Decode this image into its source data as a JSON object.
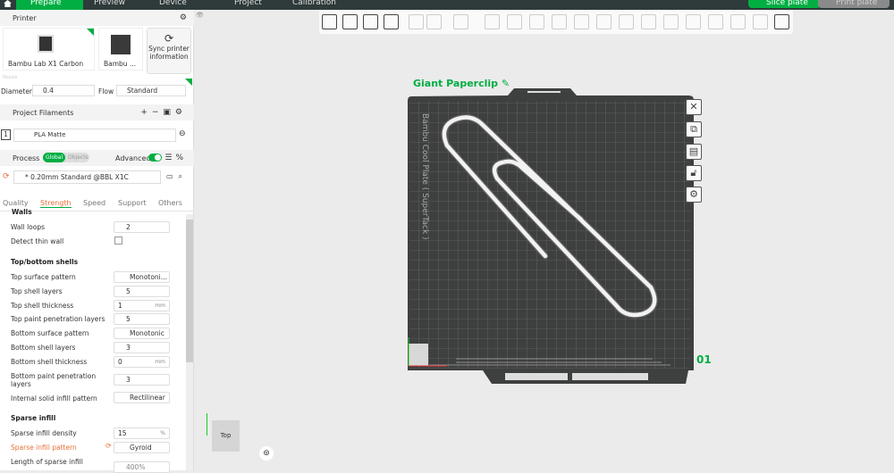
{
  "topbar": {
    "tabs": [
      "Prepare",
      "Preview",
      "Device",
      "Project",
      "Calibration"
    ],
    "slice_label": "Slice plate",
    "print_label": "Print plate"
  },
  "printer": {
    "title": "Printer",
    "name1": "Bambu Lab X1 Carbon",
    "name2": "Bambu ...",
    "sync_label": "Sync printer information",
    "nozzle_label": "Nozzle",
    "diameter_label": "Diameter",
    "diameter_value": "0.4",
    "flow_label": "Flow",
    "flow_value": "Standard"
  },
  "filaments": {
    "title": "Project Filaments",
    "items": [
      {
        "index": "1",
        "name": "PLA Matte"
      }
    ]
  },
  "process": {
    "title": "Process",
    "global_label": "Global",
    "objects_label": "Objects",
    "advanced_label": "Advanced",
    "advanced_on": true,
    "preset": "* 0.20mm Standard @BBL X1C",
    "tabs": [
      "Quality",
      "Strength",
      "Speed",
      "Support",
      "Others"
    ],
    "active_tab": "Strength"
  },
  "settings": {
    "walls_header": "Walls",
    "wall_loops_label": "Wall loops",
    "wall_loops": "2",
    "detect_thin_wall_label": "Detect thin wall",
    "detect_thin_wall": false,
    "shells_header": "Top/bottom shells",
    "top_surface_pattern_label": "Top surface pattern",
    "top_surface_pattern": "Monotoni...",
    "top_shell_layers_label": "Top shell layers",
    "top_shell_layers": "5",
    "top_shell_thickness_label": "Top shell thickness",
    "top_shell_thickness": "1",
    "mm": "mm",
    "top_paint_label": "Top paint penetration layers",
    "top_paint": "5",
    "bottom_surface_pattern_label": "Bottom surface pattern",
    "bottom_surface_pattern": "Monotonic",
    "bottom_shell_layers_label": "Bottom shell layers",
    "bottom_shell_layers": "3",
    "bottom_shell_thickness_label": "Bottom shell thickness",
    "bottom_shell_thickness": "0",
    "bottom_paint_label": "Bottom paint penetration layers",
    "bottom_paint": "3",
    "internal_pattern_label": "Internal solid infill pattern",
    "internal_pattern": "Rectilinear",
    "sparse_header": "Sparse infill",
    "density_label": "Sparse infill density",
    "density": "15",
    "percent": "%",
    "sparse_pattern_label": "Sparse infill pattern",
    "sparse_pattern": "Gyroid",
    "length_label": "Length of sparse infill",
    "length": "400%"
  },
  "viewport": {
    "plate_name": "Giant Paperclip",
    "plate_label": "Bambu Cool Plate ( SuperTack )",
    "plate_number": "01",
    "view_cube_label": "Top",
    "accent": "#00ae42"
  }
}
